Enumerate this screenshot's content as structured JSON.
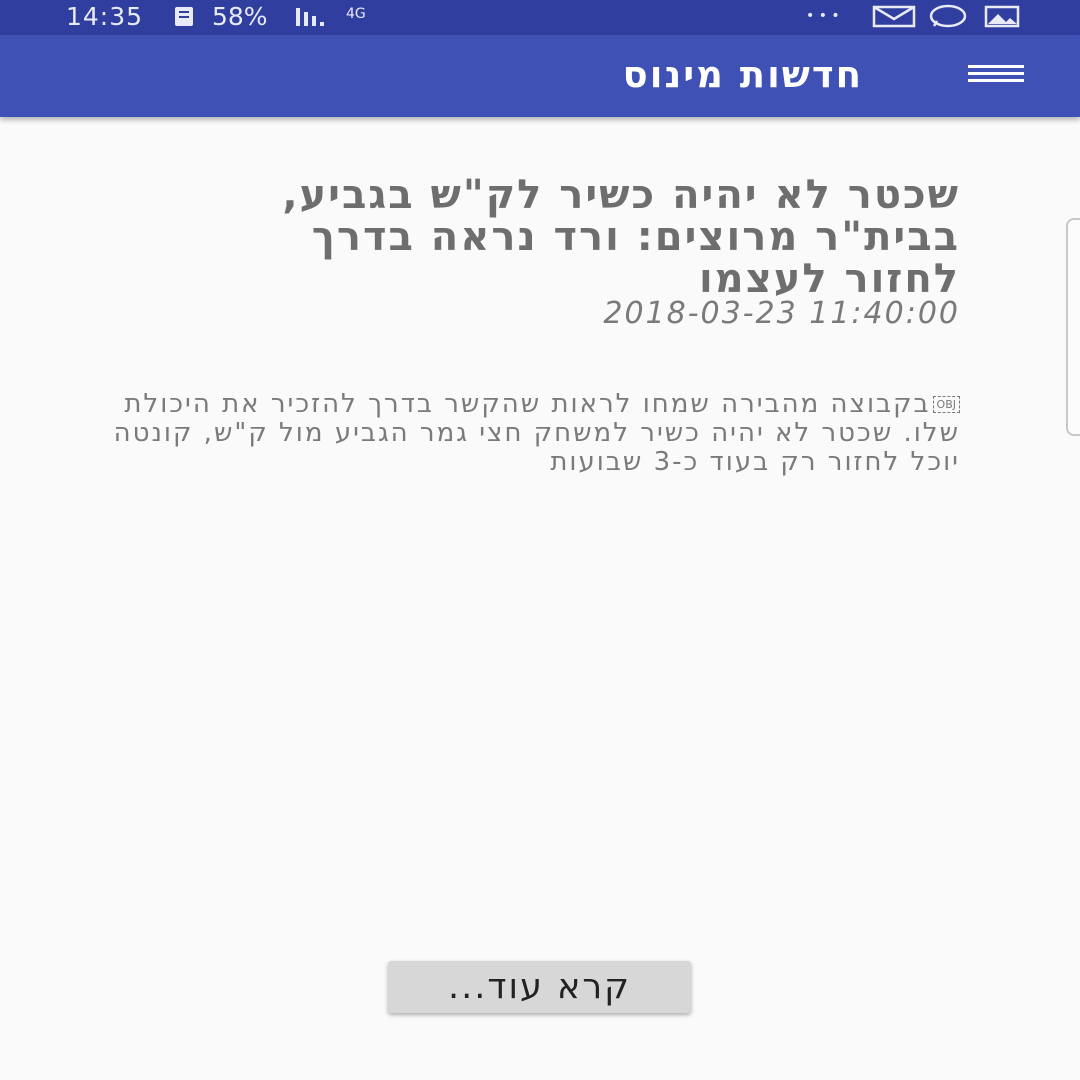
{
  "status_bar": {
    "time": "14:35",
    "battery": "58%",
    "network": "4G",
    "more": "• • •",
    "icons": [
      "clipboard-icon",
      "signal-icon",
      "network-4g-icon",
      "more-dots-icon",
      "gmail-icon",
      "whatsapp-icon",
      "gallery-icon"
    ]
  },
  "app_bar": {
    "title": "חדשות מינוס",
    "menu_icon": "hamburger-icon",
    "background_color": "#3f51b5",
    "status_color": "#303f9f"
  },
  "article": {
    "title": "שכטר לא יהיה כשיר לק\"ש בגביע, בבית\"ר מרוצים: ורד נראה בדרך לחזור לעצמו",
    "date": "2018-03-23 11:40:00",
    "obj_marker": "OBJ",
    "summary": "בקבוצה מהבירה שמחו לראות שהקשר בדרך להזכיר את היכולת שלו. שכטר לא יהיה כשיר למשחק חצי גמר הגביע מול ק\"ש, קונטה יוכל לחזור רק בעוד כ-3 שבועות"
  },
  "read_more": {
    "label": "קרא עוד..."
  }
}
